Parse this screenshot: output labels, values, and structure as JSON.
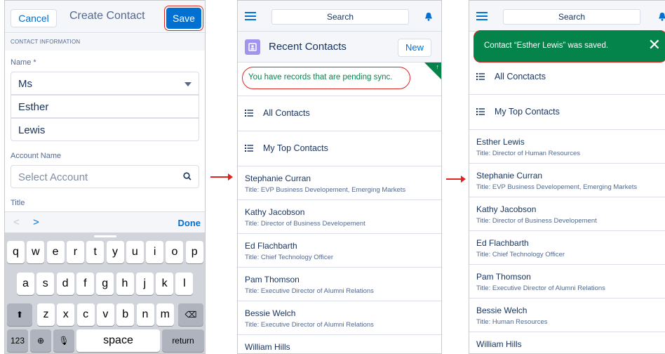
{
  "screen1": {
    "cancel_label": "Cancel",
    "title": "Create Contact",
    "save_label": "Save",
    "section_header": "CONTACT INFORMATION",
    "name_label": "Name *",
    "salutation": "Ms",
    "first_name": "Esther",
    "last_name": "Lewis",
    "account_label": "Account Name",
    "account_placeholder": "Select Account",
    "title_label": "Title",
    "kb_done": "Done",
    "kb_prev": "<",
    "kb_next": ">",
    "keyboard": {
      "row1": [
        "q",
        "w",
        "e",
        "r",
        "t",
        "y",
        "u",
        "i",
        "o",
        "p"
      ],
      "row2": [
        "a",
        "s",
        "d",
        "f",
        "g",
        "h",
        "j",
        "k",
        "l"
      ],
      "row3": [
        "z",
        "x",
        "c",
        "v",
        "b",
        "n",
        "m"
      ],
      "shift": "⬆",
      "backspace": "⌫",
      "num": "123",
      "globe": "⊕",
      "mic": "🎙",
      "space": "space",
      "return": "return"
    }
  },
  "screen2": {
    "search": "Search",
    "heading": "Recent Contacts",
    "new_label": "New",
    "pending": "You have records that are pending sync.",
    "list_all": "All Contacts",
    "list_top": "My Top Contacts",
    "contacts": [
      {
        "name": "Stephanie Curran",
        "title": "Title: EVP Business Developement, Emerging Markets"
      },
      {
        "name": "Kathy Jacobson",
        "title": "Title: Director of Business Developement"
      },
      {
        "name": "Ed Flachbarth",
        "title": "Title: Chief Technology Officer"
      },
      {
        "name": "Pam Thomson",
        "title": "Title: Executive Director of Alumni Relations"
      },
      {
        "name": "Bessie Welch",
        "title": "Title: Executive Director of Alumni Relations"
      },
      {
        "name": "William Hills",
        "title": ""
      }
    ]
  },
  "screen3": {
    "search": "Search",
    "toast": "Contact “Esther Lewis” was saved.",
    "toast_close": "✕",
    "list_all": "All Conctacts",
    "list_top": "My Top Contacts",
    "contacts": [
      {
        "name": "Esther Lewis",
        "title": "Title: Director of Human Resources"
      },
      {
        "name": "Stephanie Curran",
        "title": "Title: EVP Business Developement, Emerging Markets"
      },
      {
        "name": "Kathy Jacobson",
        "title": "Title: Director of Business Developement"
      },
      {
        "name": "Ed Flachbarth",
        "title": "Title: Chief Technology Officer"
      },
      {
        "name": "Pam Thomson",
        "title": "Title: Executive Director of Alumni Relations"
      },
      {
        "name": "Bessie Welch",
        "title": "Title: Human Resources"
      },
      {
        "name": "William Hills",
        "title": ""
      }
    ]
  },
  "colors": {
    "brand": "#0070d2",
    "success": "#04844b",
    "highlight": "#e0241f",
    "text": "#16325c"
  }
}
